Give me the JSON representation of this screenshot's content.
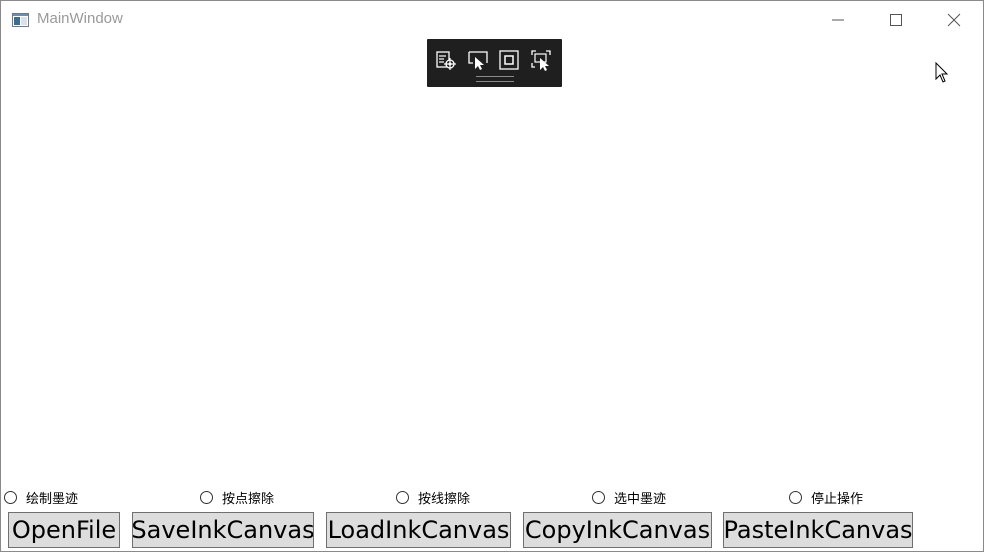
{
  "window": {
    "title": "MainWindow",
    "icon": "app-window-icon",
    "controls": [
      "minimize-icon",
      "maximize-icon",
      "close-icon"
    ]
  },
  "debug_toolbar": {
    "icons": [
      "live-visual-tree-icon",
      "select-element-icon",
      "display-layout-adorners-icon",
      "track-focused-element-icon"
    ]
  },
  "canvas": {
    "name": "InkCanvas"
  },
  "modes": [
    {
      "label": "绘制墨迹"
    },
    {
      "label": "按点擦除"
    },
    {
      "label": "按线擦除"
    },
    {
      "label": "选中墨迹"
    },
    {
      "label": "停止操作"
    }
  ],
  "buttons": [
    {
      "label": "OpenFile"
    },
    {
      "label": "SaveInkCanvas"
    },
    {
      "label": "LoadInkCanvas"
    },
    {
      "label": "CopyInkCanvas"
    },
    {
      "label": "PasteInkCanvas"
    }
  ]
}
